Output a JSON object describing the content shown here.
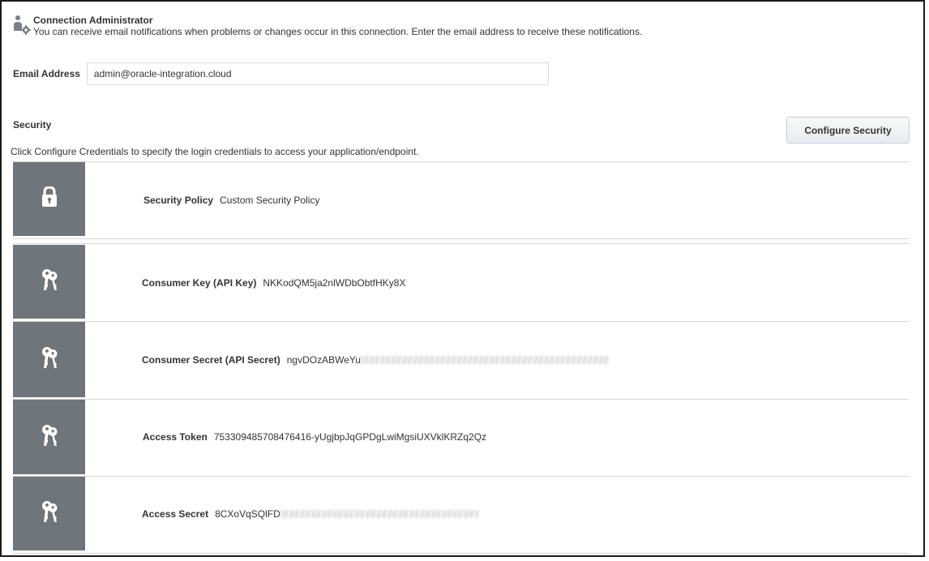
{
  "admin": {
    "title": "Connection Administrator",
    "description": "You can receive email notifications when problems or changes occur in this connection. Enter the email address to receive these notifications.",
    "icon": "admin-user-gear-icon"
  },
  "email": {
    "label": "Email Address",
    "value": "admin@oracle-integration.cloud"
  },
  "security": {
    "title": "Security",
    "configure_label": "Configure Security",
    "description": "Click Configure Credentials to specify the login credentials to access your application/endpoint."
  },
  "rows": [
    {
      "label": "Security Policy",
      "value": "Custom Security Policy",
      "icon": "lock-icon"
    },
    {
      "label": "Consumer Key (API Key)",
      "value": "NKKodQM5ja2nlWDbObtfHKy8X",
      "icon": "keys-icon"
    },
    {
      "label": "Consumer Secret (API Secret)",
      "value": "ngvDOzABWeYu",
      "icon": "keys-icon",
      "masked": true
    },
    {
      "label": "Access Token",
      "value": "753309485708476416-yUgjbpJqGPDgLwiMgsiUXVklKRZq2Qz",
      "icon": "keys-icon"
    },
    {
      "label": "Access Secret",
      "value": "8CXoVqSQlFD",
      "icon": "keys-icon",
      "masked": true
    }
  ],
  "colors": {
    "tile": "#6e757b",
    "text": "#333333",
    "divider": "#d6d6d6"
  }
}
